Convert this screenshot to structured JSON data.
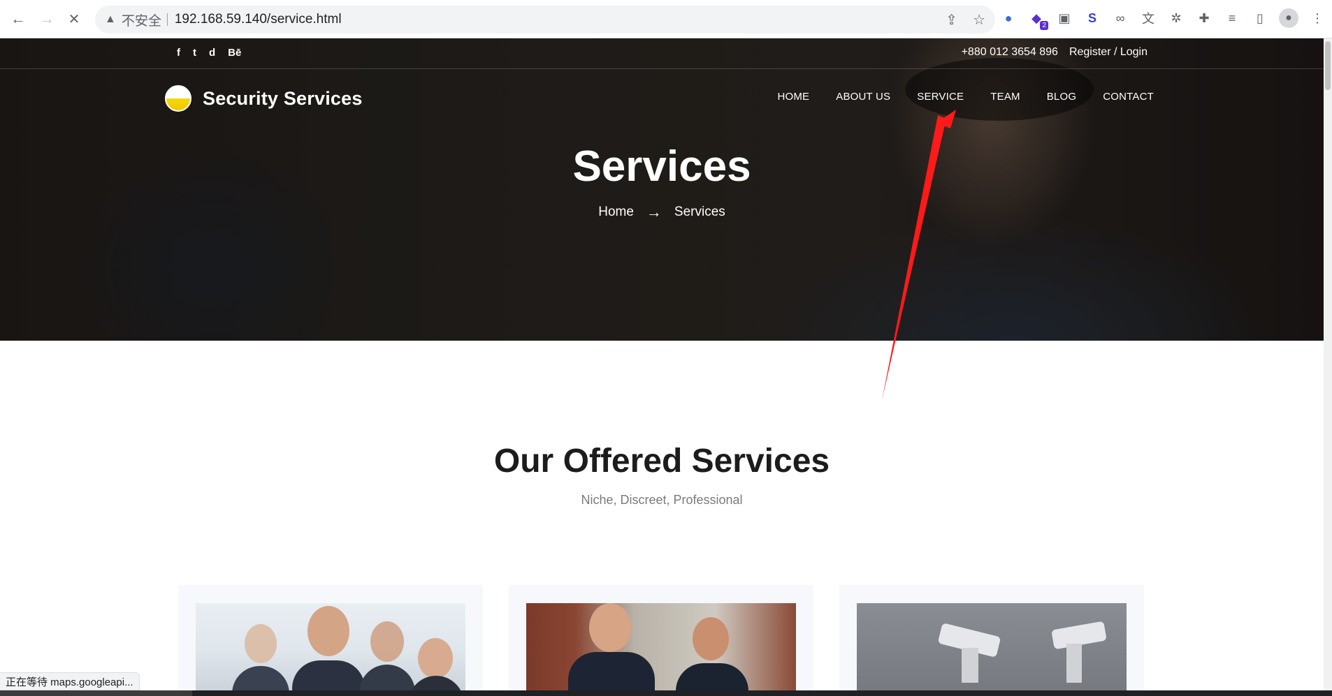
{
  "browser": {
    "insecure_label": "不安全",
    "url": "192.168.59.140/service.html",
    "back_glyph": "←",
    "forward_glyph": "→",
    "stop_glyph": "✕",
    "extension_badge": "2",
    "icons": [
      "share-icon",
      "star-icon",
      "globe-extension-icon",
      "purple-extension-icon",
      "panda-extension-icon",
      "s-extension-icon",
      "link-extension-icon",
      "translate-icon",
      "puzzle-extension-icon",
      "extensions-icon",
      "reading-list-icon",
      "side-panel-icon",
      "profile-avatar-icon"
    ]
  },
  "site": {
    "brand": "Security Services",
    "phone": "+880 012 3654 896",
    "auth_link": "Register / Login",
    "social": [
      "f",
      "t",
      "d",
      "Bē"
    ],
    "nav": {
      "home": "HOME",
      "about": "ABOUT US",
      "service": "SERVICE",
      "team": "TEAM",
      "blog": "BLOG",
      "contact": "CONTACT"
    },
    "hero": {
      "title": "Services",
      "breadcrumb_home": "Home",
      "breadcrumb_arrow": "→",
      "breadcrumb_current": "Services"
    },
    "section": {
      "title": "Our Offered Services",
      "subtitle": "Niche, Discreet, Professional"
    },
    "cards": [
      {
        "image": "business-team-photo"
      },
      {
        "image": "police-officers-photo"
      },
      {
        "image": "security-cameras-photo"
      }
    ]
  },
  "status_bar": "正在等待 maps.googleapi...",
  "annotation": {
    "color": "#ff1a1a"
  },
  "colors": {
    "accent_yellow": "#f2c500",
    "hero_dark": "#231e1b"
  }
}
